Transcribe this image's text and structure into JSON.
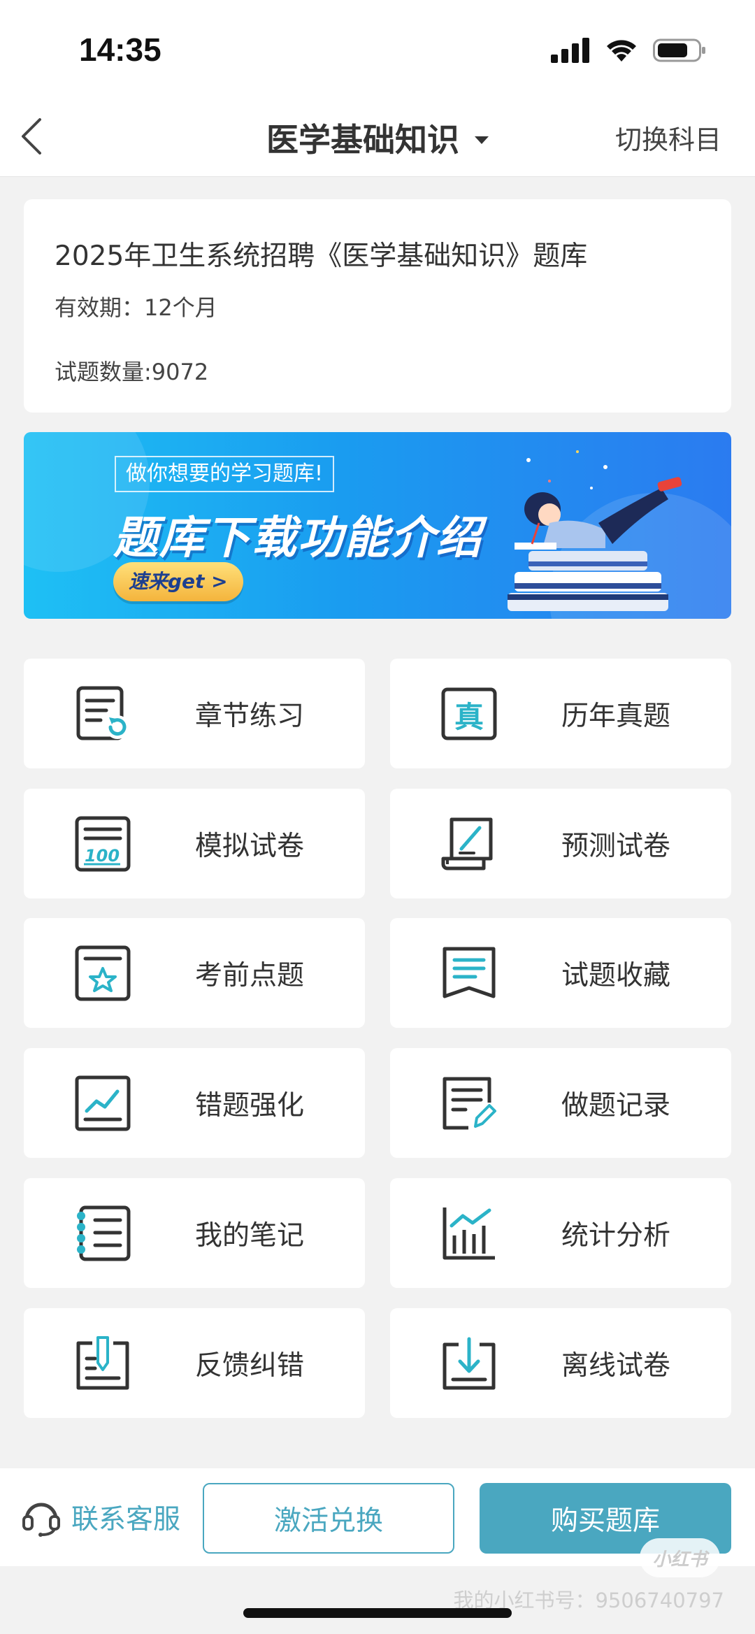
{
  "status_bar": {
    "time": "14:35"
  },
  "nav": {
    "title": "医学基础知识",
    "right_action": "切换科目"
  },
  "info_card": {
    "title": "2025年卫生系统招聘《医学基础知识》题库",
    "validity": "有效期：12个月",
    "question_count": "试题数量:9072"
  },
  "banner": {
    "tag": "做你想要的学习题库!",
    "heading": "题库下载功能介绍",
    "button": "速来get >"
  },
  "grid": [
    {
      "label": "章节练习",
      "icon": "chapter-practice-icon"
    },
    {
      "label": "历年真题",
      "icon": "past-exams-icon"
    },
    {
      "label": "模拟试卷",
      "icon": "mock-exam-icon"
    },
    {
      "label": "预测试卷",
      "icon": "prediction-exam-icon"
    },
    {
      "label": "考前点题",
      "icon": "pre-exam-star-icon"
    },
    {
      "label": "试题收藏",
      "icon": "bookmark-icon"
    },
    {
      "label": "错题强化",
      "icon": "trend-chart-icon"
    },
    {
      "label": "做题记录",
      "icon": "record-edit-icon"
    },
    {
      "label": "我的笔记",
      "icon": "notebook-icon"
    },
    {
      "label": "统计分析",
      "icon": "bar-chart-icon"
    },
    {
      "label": "反馈纠错",
      "icon": "feedback-pen-icon"
    },
    {
      "label": "离线试卷",
      "icon": "download-icon"
    }
  ],
  "bottom_bar": {
    "contact_label": "联系客服",
    "activate_label": "激活兑换",
    "buy_label": "购买题库"
  },
  "overlay": {
    "badge": "小红书",
    "watermark": "我的小红书号：9506740797"
  },
  "colors": {
    "accent": "#4aa7c0",
    "icon_teal": "#2bb3c8",
    "icon_dark": "#333333",
    "background": "#f2f2f2"
  }
}
